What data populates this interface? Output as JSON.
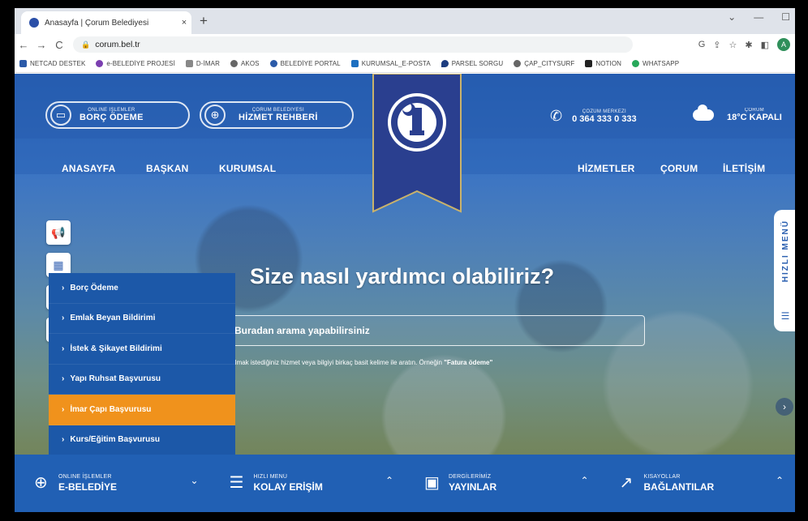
{
  "browser": {
    "tab_title": "Anasayfa | Çorum Belediyesi",
    "tab_close": "×",
    "new_tab": "+",
    "url": "corum.bel.tr",
    "bookmarks": [
      "NETCAD DESTEK",
      "e-BELEDİYE PROJESİ",
      "D-İMAR",
      "AKOS",
      "BELEDİYE PORTAL",
      "KURUMSAL_E-POSTA",
      "PARSEL SORGU",
      "ÇAP_CITYSURF",
      "NOTION",
      "WHATSAPP"
    ],
    "profile_letter": "A"
  },
  "header": {
    "borc": {
      "small": "ONLINE İŞLEMLER",
      "big": "BORÇ ÖDEME"
    },
    "rehber": {
      "small": "ÇORUM BELEDİYESİ",
      "big": "HİZMET REHBERİ"
    },
    "phone": {
      "small": "ÇÖZÜM MERKEZİ",
      "number": "0 364 333 0 333"
    },
    "weather": {
      "small": "ÇORUM",
      "text": "18°C KAPALI"
    }
  },
  "nav": {
    "left": [
      "ANASAYFA",
      "BAŞKAN",
      "KURUMSAL"
    ],
    "right": [
      "HİZMETLER",
      "ÇORUM",
      "İLETİŞİM"
    ]
  },
  "hero": {
    "title": "Size nasıl yardımcı olabiliriz?",
    "search_placeholder": "Buradan arama yapabilirsiniz",
    "hint_prefix": "Bulmak istediğiniz hizmet veya bilgiyi birkaç basit kelime ile aratın. Örneğin",
    "hint_example": "\"Fatura ödeme\""
  },
  "quick_menu": {
    "items": [
      "Borç Ödeme",
      "Emlak Beyan Bildirimi",
      "İstek & Şikayet Bildirimi",
      "Yapı Ruhsat Başvurusu",
      "İmar Çapı Başvurusu",
      "Kurs/Eğitim Başvurusu"
    ],
    "active_index": 4
  },
  "side_tab": {
    "label": "HIZLI MENÜ"
  },
  "bottom": [
    {
      "small": "ONLINE İŞLEMLER",
      "big": "E-BELEDİYE",
      "caret": "⌄",
      "icon": "globe-icon"
    },
    {
      "small": "HIZLI MENÜ",
      "big": "KOLAY ERİŞİM",
      "caret": "⌃",
      "icon": "hamburger-icon"
    },
    {
      "small": "DERGİLERİMİZ",
      "big": "YAYINLAR",
      "caret": "⌃",
      "icon": "magazine-icon"
    },
    {
      "small": "KISAYOLLAR",
      "big": "BAĞLANTILAR",
      "caret": "⌃",
      "icon": "external-link-icon"
    }
  ],
  "colors": {
    "primary": "#2160b4",
    "accent": "#f0921c",
    "ribbon": "#2a3f8f"
  }
}
